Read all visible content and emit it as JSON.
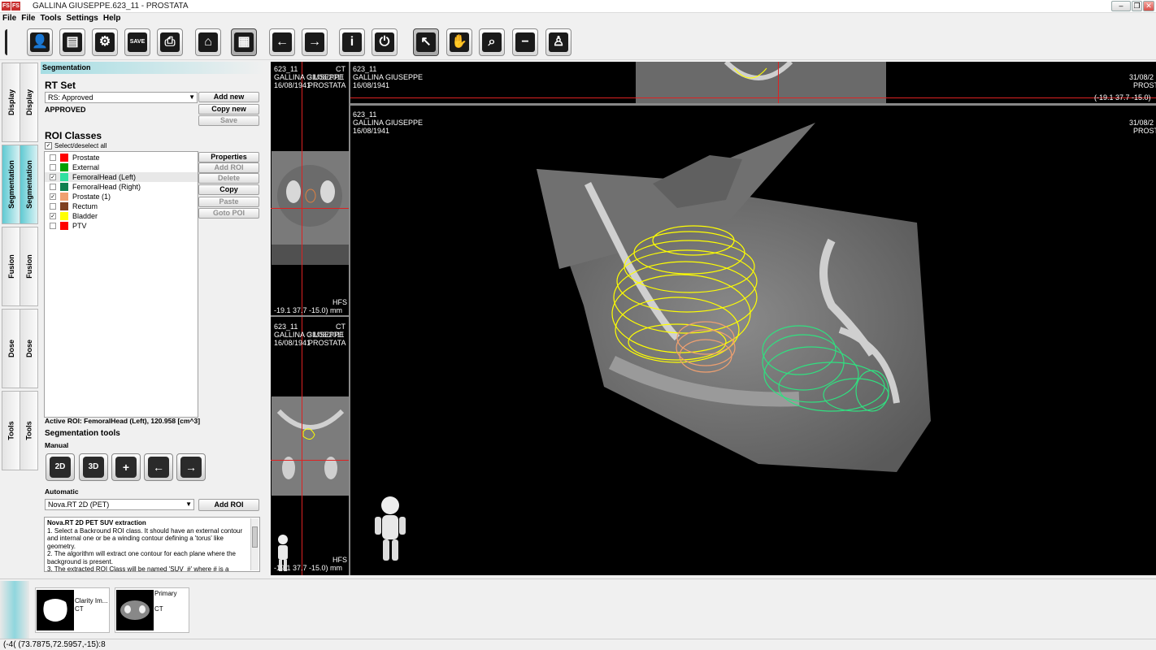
{
  "window": {
    "title": "GALLINA GIUSEPPE.623_11 - PROSTATA",
    "app_icon_text": [
      "FS",
      "FS"
    ],
    "minimize": "–",
    "restore": "❐",
    "close": "✕"
  },
  "menu": [
    "File",
    "File",
    "Tools",
    "Settings",
    "Help"
  ],
  "toolbar": {
    "icons": [
      "patient-icon",
      "patient-info-icon",
      "patient-settings-icon",
      "save-icon",
      "print-icon",
      "home-icon",
      "notes-icon",
      "arrow-left-icon",
      "arrow-right-icon",
      "info-icon",
      "power-icon",
      "pointer-icon",
      "hand-icon",
      "zoom-icon",
      "zoom-minus-icon",
      "person-icon"
    ],
    "glyphs": [
      "👤",
      "▤",
      "⚙",
      "SAVE",
      "⎙",
      "⌂",
      "▦",
      "←",
      "→",
      "i",
      "⏻",
      "↖",
      "✋",
      "⌕",
      "−",
      "♙"
    ]
  },
  "sidetabs": [
    "Display",
    "Display",
    "Segmentation",
    "Segmentation",
    "Fusion",
    "Fusion",
    "Dose",
    "Dose",
    "Tools",
    "Tools"
  ],
  "panel": {
    "header": "Segmentation",
    "rtset_title": "RT Set",
    "rtset_value": "RS: Approved",
    "rtset_status": "APPROVED",
    "btn_add_new": "Add new",
    "btn_copy_new": "Copy new",
    "btn_save": "Save",
    "roi_title": "ROI Classes",
    "select_all": "Select/deselect all",
    "rois": [
      {
        "name": "Prostate",
        "color": "#ff0000",
        "checked": false
      },
      {
        "name": "External",
        "color": "#00a000",
        "checked": false
      },
      {
        "name": "FemoralHead (Left)",
        "color": "#30e0a0",
        "checked": true
      },
      {
        "name": "FemoralHead (Right)",
        "color": "#108050",
        "checked": false
      },
      {
        "name": "Prostate (1)",
        "color": "#f0a070",
        "checked": true
      },
      {
        "name": "Rectum",
        "color": "#804020",
        "checked": false
      },
      {
        "name": "Bladder",
        "color": "#ffff00",
        "checked": true
      },
      {
        "name": "PTV",
        "color": "#ff0000",
        "checked": false
      }
    ],
    "roi_buttons": [
      "Properties",
      "Add ROI",
      "Delete",
      "Copy",
      "Paste",
      "Goto POI"
    ],
    "active_roi": "Active ROI: FemoralHead (Left), 120.958 [cm^3]",
    "seg_tools_title": "Segmentation tools",
    "manual_label": "Manual",
    "manual_buttons": [
      "2D",
      "3D",
      "+",
      "←",
      "→"
    ],
    "automatic_label": "Automatic",
    "auto_value": "Nova.RT 2D (PET)",
    "btn_add_roi": "Add ROI",
    "desc_title": "Nova.RT 2D PET SUV extraction",
    "desc_text": "1. Select a Backround ROI class. It should have an external contour and internal one or be a winding contour defining a 'torus' like geometry.\n2. The algorithm will extract one contour for each plane where the background is present.\n3. The extracted ROI Class will be named 'SUV_#' where # is a"
  },
  "viewer": {
    "small_top": {
      "id": "623_11",
      "mod": "CT",
      "name": "GALLINA GIUSEPPE",
      "date1": "31/08/2011",
      "dob": "16/08/1941",
      "study": "PROSTATA",
      "hfs": "HFS",
      "coord": "-19.1 37.7 -15.0) mm"
    },
    "small_bottom": {
      "id": "623_11",
      "mod": "CT",
      "name": "GALLINA GIUSEPPE",
      "date1": "31/08/2011",
      "dob": "16/08/1941",
      "study": "PROSTATA",
      "hfs": "HFS",
      "coord": "-19.1 37.7 -15.0) mm"
    },
    "strip_top": {
      "id": "623_11",
      "name": "GALLINA GIUSEPPE",
      "dob": "16/08/1941",
      "date": "31/08/2",
      "study": "PROST",
      "coord": "(-19.1 37.7 -15.0)"
    },
    "main": {
      "id": "623_11",
      "name": "GALLINA GIUSEPPE",
      "dob": "16/08/1941",
      "date": "31/08/2",
      "study": "PROST"
    }
  },
  "thumbs": [
    {
      "title": "Clarity Im...",
      "mod": "CT"
    },
    {
      "title": "Primary",
      "mod": "CT"
    }
  ],
  "status": "(-4( (73.7875,72.5957,-15):8"
}
